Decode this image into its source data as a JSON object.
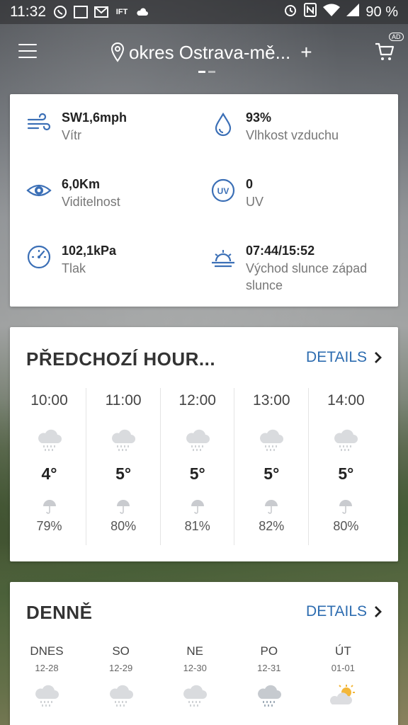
{
  "status_bar": {
    "time": "11:32",
    "calendar_badge": "30",
    "ift_label": "IFT",
    "battery": "90 %"
  },
  "header": {
    "location": "okres Ostrava-mě...",
    "plus": "+",
    "ad_badge": "AD"
  },
  "details": {
    "wind": {
      "value": "SW1,6mph",
      "label": "Vítr"
    },
    "humidity": {
      "value": "93%",
      "label": "Vlhkost vzduchu"
    },
    "visibility": {
      "value": "6,0Km",
      "label": "Viditelnost"
    },
    "uv": {
      "value": "0",
      "label": "UV",
      "icon_text": "UV"
    },
    "pressure": {
      "value": "102,1kPa",
      "label": "Tlak"
    },
    "sun": {
      "value": "07:44/15:52",
      "label_line1": "Východ slunce západ",
      "label_line2": "slunce"
    }
  },
  "hourly": {
    "title": "PŘEDCHOZÍ HOUR...",
    "link": "DETAILS",
    "hours": [
      {
        "time": "10:00",
        "temp": "4°",
        "precip": "79%"
      },
      {
        "time": "11:00",
        "temp": "5°",
        "precip": "80%"
      },
      {
        "time": "12:00",
        "temp": "5°",
        "precip": "81%"
      },
      {
        "time": "13:00",
        "temp": "5°",
        "precip": "82%"
      },
      {
        "time": "14:00",
        "temp": "5°",
        "precip": "80%"
      }
    ]
  },
  "daily": {
    "title": "DENNĚ",
    "link": "DETAILS",
    "days": [
      {
        "name": "DNES",
        "date": "12-28",
        "icon": "rain-cloud-icon"
      },
      {
        "name": "SO",
        "date": "12-29",
        "icon": "rain-cloud-icon"
      },
      {
        "name": "NE",
        "date": "12-30",
        "icon": "rain-cloud-icon"
      },
      {
        "name": "PO",
        "date": "12-31",
        "icon": "rain-cloud-icon"
      },
      {
        "name": "ÚT",
        "date": "01-01",
        "icon": "partly-sunny-icon"
      }
    ]
  },
  "colors": {
    "accent": "#2d6cb0",
    "icon_blue": "#3b6fb6"
  }
}
